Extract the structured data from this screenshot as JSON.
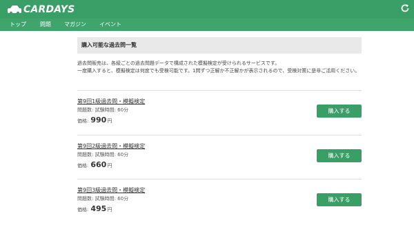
{
  "header": {
    "logo_text": "CARDAYS",
    "refresh_icon": "refresh-icon"
  },
  "nav": {
    "items": [
      {
        "label": "トップ"
      },
      {
        "label": "問題"
      },
      {
        "label": "マガジン"
      },
      {
        "label": "イベント"
      }
    ]
  },
  "section": {
    "title": "購入可能な過去問一覧",
    "intro_line1": "過去問販売は、各級ごとの過去問題データで構成された模擬検定が受けられるサービスです。",
    "intro_line2": "一度購入すると、模擬検定は何度でも受検可能です。1問ずつ正解か不正解かが表示されるので、受検対策に是非ご活用ください。"
  },
  "products": [
    {
      "title": "第9回1級過去問・模擬検定",
      "meta": "問題数: 試験時間: 60分",
      "price_label": "価格:",
      "price": "990",
      "currency": "円",
      "buy_label": "購入する"
    },
    {
      "title": "第9回2級過去問・模擬検定",
      "meta": "問題数: 試験時間: 60分",
      "price_label": "価格:",
      "price": "660",
      "currency": "円",
      "buy_label": "購入する"
    },
    {
      "title": "第9回3級過去問・模擬検定",
      "meta": "問題数: 試験時間: 60分",
      "price_label": "価格:",
      "price": "495",
      "currency": "円",
      "buy_label": "購入する"
    }
  ],
  "colors": {
    "brand_green": "#3a9e67",
    "nav_green": "#3fa56d",
    "section_bg": "#e9e9e9"
  }
}
